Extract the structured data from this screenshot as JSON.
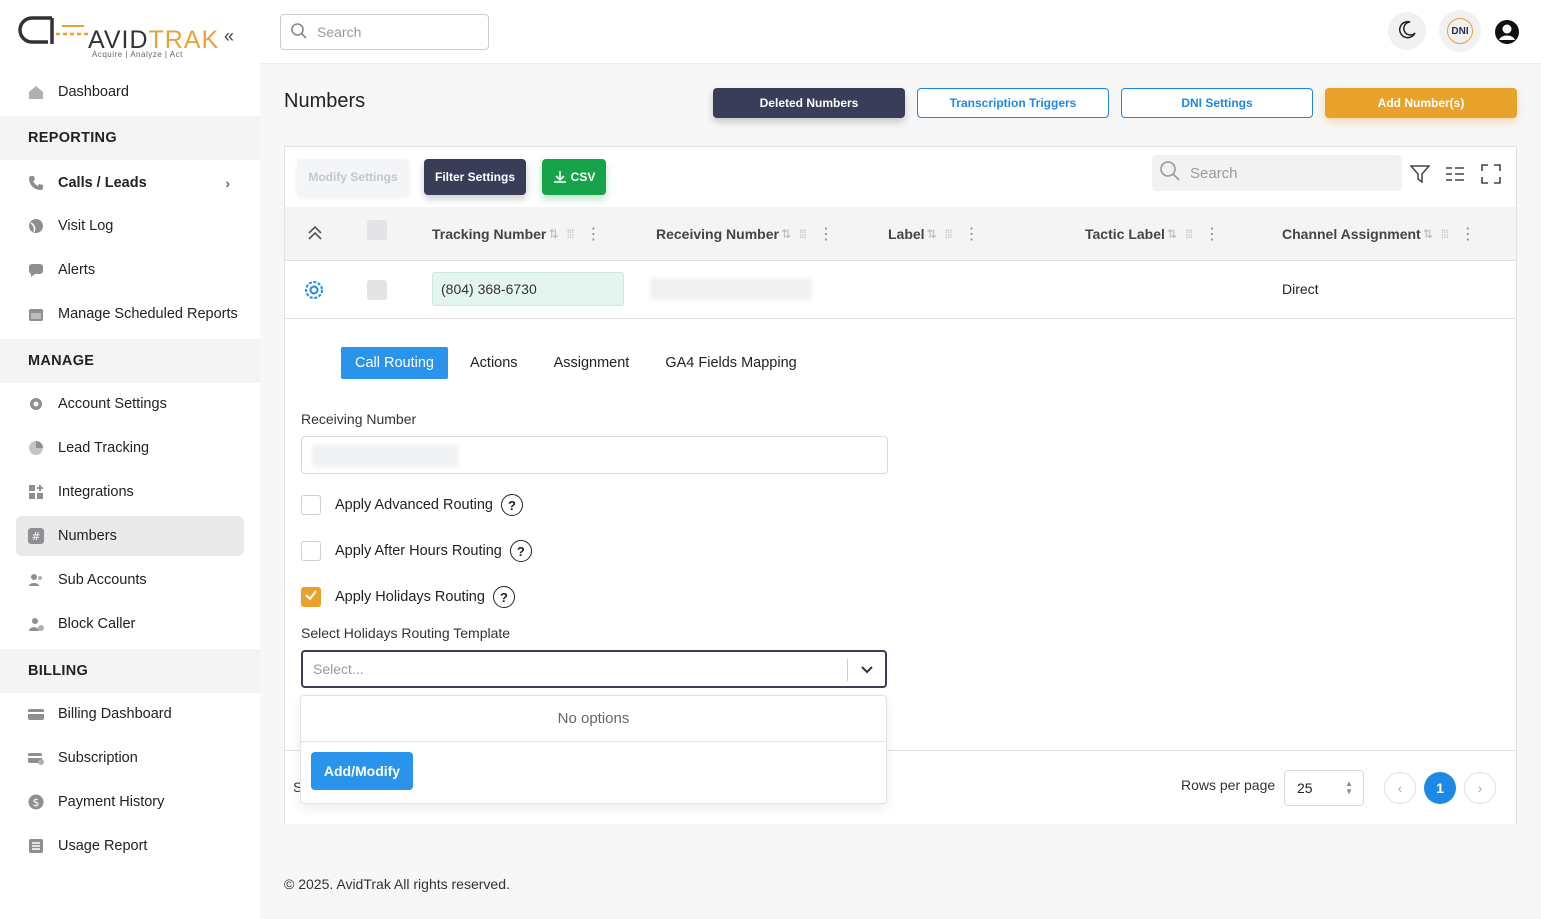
{
  "logo": {
    "brand_avid": "AVID",
    "brand_trak": "TRAK",
    "tagline": "Acquire  |  Analyze  |  Act"
  },
  "sidebar": {
    "collapse_icon": "double-chevron-left",
    "items": [
      {
        "label": "Dashboard",
        "icon": "home-icon"
      },
      {
        "label": "Calls / Leads",
        "icon": "phone-icon"
      },
      {
        "label": "Visit Log",
        "icon": "globe-icon"
      },
      {
        "label": "Alerts",
        "icon": "chat-icon"
      },
      {
        "label": "Manage Scheduled Reports",
        "icon": "calendar-icon"
      },
      {
        "label": "Account Settings",
        "icon": "gear-icon"
      },
      {
        "label": "Lead Tracking",
        "icon": "pie-icon"
      },
      {
        "label": "Integrations",
        "icon": "grid-plus-icon"
      },
      {
        "label": "Numbers",
        "icon": "hash-icon"
      },
      {
        "label": "Sub Accounts",
        "icon": "users-icon"
      },
      {
        "label": "Block Caller",
        "icon": "user-block-icon"
      },
      {
        "label": "Billing Dashboard",
        "icon": "card-icon"
      },
      {
        "label": "Subscription",
        "icon": "card-clock-icon"
      },
      {
        "label": "Payment History",
        "icon": "dollar-icon"
      },
      {
        "label": "Usage Report",
        "icon": "list-icon"
      }
    ],
    "sections": {
      "reporting": "REPORTING",
      "manage": "MANAGE",
      "billing": "BILLING"
    }
  },
  "topbar": {
    "search_placeholder": "Search",
    "dni_badge": "DNI"
  },
  "page": {
    "title": "Numbers",
    "buttons": {
      "deleted": "Deleted Numbers",
      "transcription": "Transcription Triggers",
      "dni_settings": "DNI Settings",
      "add_number": "Add Number(s)"
    }
  },
  "toolbar": {
    "modify_settings": "Modify Settings",
    "filter_settings": "Filter Settings",
    "csv": "CSV",
    "search_placeholder": "Search"
  },
  "table": {
    "columns": [
      "Tracking Number",
      "Receiving Number",
      "Label",
      "Tactic Label",
      "Channel Assignment"
    ],
    "row": {
      "tracking_number": "(804) 368-6730",
      "channel_assignment": "Direct"
    }
  },
  "panel": {
    "tabs": [
      "Call Routing",
      "Actions",
      "Assignment",
      "GA4 Fields Mapping"
    ],
    "active_tab": "Call Routing",
    "receiving_number_label": "Receiving Number",
    "checks": {
      "advanced": "Apply Advanced Routing",
      "after_hours": "Apply After Hours Routing",
      "holidays": "Apply Holidays Routing"
    },
    "holidays_checked": true,
    "template_label": "Select Holidays Routing Template",
    "select_placeholder": "Select...",
    "dropdown": {
      "no_options": "No options",
      "add_modify": "Add/Modify"
    },
    "help": "?"
  },
  "pagination": {
    "s_fragment": "S",
    "rows_per_page_label": "Rows per page",
    "rows_per_page": "25",
    "current_page": "1"
  },
  "footer": {
    "copyright": "© 2025. AvidTrak All rights reserved."
  },
  "colors": {
    "accent_orange": "#e8a12a",
    "accent_blue": "#2a93ec",
    "dark_navy": "#3a3d57",
    "csv_green": "#17a34a"
  }
}
